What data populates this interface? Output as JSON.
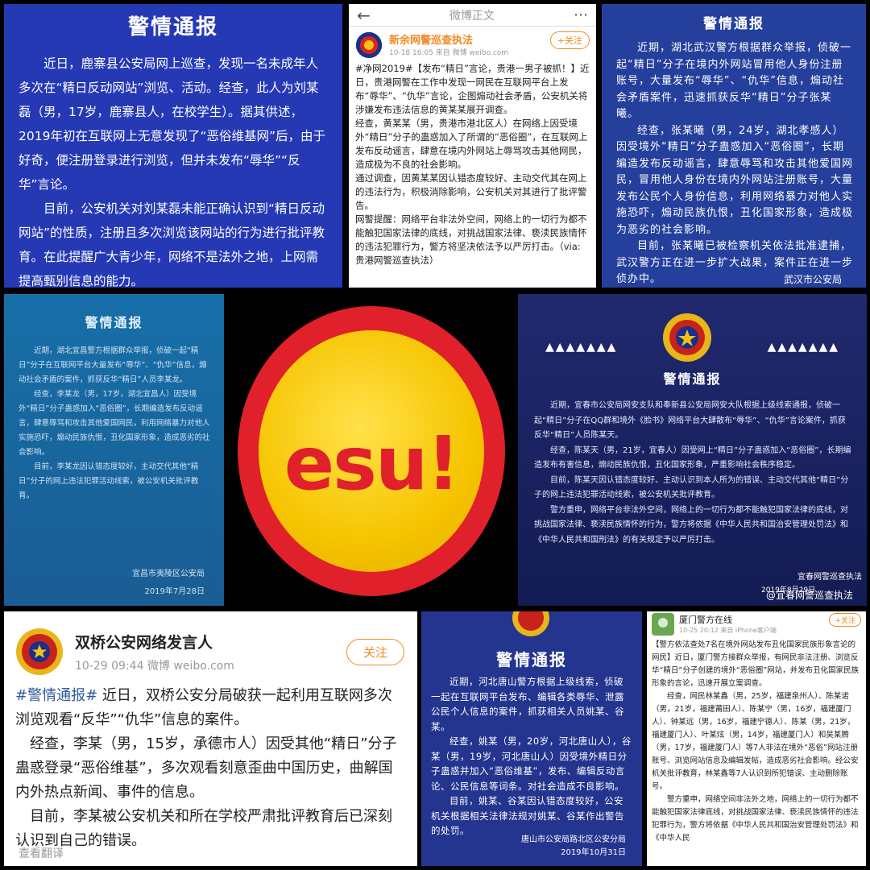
{
  "panel1": {
    "title": "警情通报",
    "paragraphs": [
      "近日，鹿寨县公安局网上巡查，发现一名未成年人多次在“精日反动网站”浏览、活动。经查，此人为刘某磊（男，17岁，鹿寨县人，在校学生）。据其供述，2019年初在互联网上无意发现了“恶俗维基网”后，由于好奇，便注册登录进行浏览，但并未发布“辱华”“反华”言论。",
      "目前，公安机关对刘某磊未能正确认识到“精日反动网站”的性质，注册且多次浏览该网站的行为进行批评教育。在此提醒广大青少年，网络不是法外之地，上网需提高甄别信息的能力。"
    ]
  },
  "panel2": {
    "back_icon": "back-arrow-icon",
    "page_title": "微博正文",
    "more_icon": "more-icon",
    "account_name": "新余网警巡查执法",
    "meta": "10-18 16:05  来自 微博 weibo.com",
    "follow_label": "+关注",
    "paragraphs": [
      "#净网2019#【发布“精日”言论，贵港一男子被抓！】近日，贵港网警在工作中发现一网民在互联网平台上发布“辱华”、“仇华”言论，企图煽动社会矛盾，公安机关将涉嫌发布违法信息的黄某某展开调查。",
      "经查，黄某某（男，贵港市港北区人）在网络上因受境外“精日”分子的蛊惑加入了所谓的“恶俗圈”，在互联网上发布反动谣言，肆意在境内外网站上辱骂攻击其他网民，造成极为不良的社会影响。",
      "通过调查，因黄某某因认错态度较好、主动交代其在网上的违法行为，积极消除影响，公安机关对其进行了批评警告。",
      "网警提醒：网络平台非法外空间，网络上的一切行为都不能触犯国家法律的底线，对挑战国家法律、亵渎民族情怀的违法犯罪行为，警方将坚决依法予以严厉打击。（via:贵港网警巡查执法）"
    ]
  },
  "panel3": {
    "title": "警情通报",
    "paragraphs": [
      "近期，湖北武汉警方根据群众举报，侦破一起“精日”分子在境内外网站冒用他人身份注册账号，大量发布“辱华”、“仇华”信息，煽动社会矛盾案件，迅速抓获反华“精日”分子张某曦。",
      "经查，张某曦（男，24岁，湖北孝感人）因受境外“精日”分子蛊惑加入“恶俗圈”，长期编造发布反动谣言，肆意辱骂和攻击其他爱国网民，冒用他人身份在境内外网站注册账号，大量发布公民个人身份信息，利用网络暴力对他人实施恐吓，煽动民族仇恨，丑化国家形象，造成极为恶劣的社会影响。",
      "目前，张某曦已被检察机关依法批准逮捕，武汉警方正在进一步扩大战果，案件正在进一步侦办中。"
    ],
    "signature": "武汉市公安局"
  },
  "panel4": {
    "title": "警情通报",
    "paragraphs": [
      "近期，湖北宜昌警方根据群众举报，侦破一起“精日”分子在互联网平台大量发布“辱华”、“仇华”信息，煽动社会矛盾的案件，抓获反华“精日”人员李某龙。",
      "经查，李某龙（男，17岁，湖北宜昌人）因受境外“精日”分子蛊惑加入“恶俗圈”，长期编造发布反动谣言，肆意辱骂和攻击其他爱国网民，利用网络暴力对他人实施恐吓，煽动民族仇恨，丑化国家形象，造成恶劣的社会影响。",
      "目前，李某龙因认错态度较好，主动交代其他“精日”分子的网上违法犯罪活动线索，被公安机关批评教育。"
    ],
    "signature": "宜昌市夷陵区公安局",
    "date": "2019年7月28日"
  },
  "badge": {
    "text": "esu!",
    "ring_color": "#e0202a",
    "coin_color": "#f6c400"
  },
  "panel5": {
    "chevrons": "▲▲▲▲▲▲▲",
    "title": "警情通报",
    "paragraphs": [
      "近期，宜春市公安局网安支队和奉新县公安局网安大队根据上级线索通报，侦破一起“精日”分子在QQ群和境外《脸书》网络平台大肆散布“辱华”、“仇华”言论案件，抓获反华“精日”人员陈某天。",
      "经查，陈某天（男，21岁，宜春人）因受网上“精日”分子蛊惑加入“恶俗圈”，长期编造发布有害信息，煽动民族仇恨，丑化国家形象，严重影响社会秩序稳定。",
      "目前，陈某天因认错态度较好、主动认识到本人所为的错误、主动交代其他“精日”分子的网上违法犯罪活动线索，被公安机关批评教育。",
      "警方重申，网络平台非法外空间，网络上的一切行为都不能触犯国家法律的底线，对挑战国家法律、亵渎民族情怀的行为，警方将依据《中华人民共和国治安管理处罚法》和《中华人民共和国刑法》的有关规定予以严厉打击。"
    ],
    "signature": "宜春网警巡查执法",
    "date": "2019年8月29日",
    "watermark": "@宜春网警巡查执法"
  },
  "panel6": {
    "account_name": "双桥公安网络发言人",
    "meta": "10-29 09:44  微博 weibo.com",
    "follow_label": "关注",
    "hashtag": "#警情通报#",
    "paragraphs": [
      "近日，双桥公安分局破获一起利用互联网多次浏览观看“反华”“仇华”信息的案件。",
      "经查，李某（男，15岁，承德市人）因受其他“精日”分子蛊惑登录“恶俗维基”，多次观看刻意歪曲中国历史，曲解国内外热点新闻、事件的信息。",
      "目前，李某被公安机关和所在学校严肃批评教育后已深刻认识到自己的错误。"
    ],
    "translate_label": "查看翻译"
  },
  "panel7": {
    "title": "警情通报",
    "paragraphs": [
      "近期，河北唐山警方根据上级线索，侦破一起在互联网平台发布、编辑各类辱华、泄露公民个人信息的案件，抓获相关人员姚某、谷某。",
      "经查，姚某（男，20岁，河北唐山人），谷某（男，19岁，河北唐山人）因受境外精日分子蛊惑并加入“恶俗维基”，发布、编辑反动言论、公民信息等词条。对社会造成不良影响。",
      "目前，姚某、谷某因认错态度较好，公安机关根据相关法律法规对姚某、谷某作出警告的处罚。"
    ],
    "signature": "唐山市公安局路北区公安分局",
    "date": "2019年10月31日"
  },
  "panel8": {
    "account_name": "厦门警方在线",
    "meta": "10-25 20:12  来自 iPhone客户端",
    "follow_label": "+关注",
    "paragraphs": [
      "【警方依法查处7名在境外网站发布丑化国家民族形象言论的网民】近日，厦门警方接群众举报，有网民非法注册、浏览反华“精日”分子创建的境外“恶俗圈”网站，并发布丑化国家民族形象的言论，迅速开展立案调查。",
      "经查，网民林某鑫（男，25岁，福建泉州人）、陈某诺（男，21岁，福建莆田人）、陈某宁（男，16岁，福建厦门人）、钟某远（男，16岁，福建宁德人）、陈某（男，21岁，福建厦门人）、叶某炫（男，14岁，福建厦门人）和吴某腾（男，17岁，福建厦门人）等7人非法在境外“恶俗”网站注册账号、浏览网站信息及编辑发帖，造成恶劣社会影响。经公安机关批评教育，林某鑫等7人认识到所犯错误、主动删除账号。",
      "警方重申，网络空间非法外之地，网络上的一切行为都不能触犯国家法律底线，对挑战国家法律、亵渎民族情怀的违法犯罪行为，警方将依据《中华人民共和国治安管理处罚法》和《中华人民"
    ]
  }
}
